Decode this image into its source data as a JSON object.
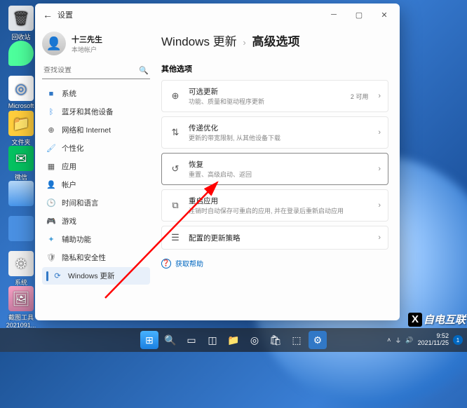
{
  "desktop": {
    "icons": [
      {
        "label": "回收站"
      },
      {
        "label": ""
      },
      {
        "label": "Microsoft Edge"
      },
      {
        "label": "文件夹"
      },
      {
        "label": "微信"
      },
      {
        "label": ""
      },
      {
        "label": ""
      },
      {
        "label": "系统"
      },
      {
        "label": "截图工具 2021091..."
      }
    ]
  },
  "window": {
    "title": "设置",
    "user": {
      "name": "十三先生",
      "sub": "本地帐户"
    },
    "search_placeholder": "查找设置",
    "nav": [
      {
        "icon": "■",
        "color": "#3178c6",
        "label": "系统"
      },
      {
        "icon": "ᛒ",
        "color": "#3a8ee8",
        "label": "蓝牙和其他设备"
      },
      {
        "icon": "⊕",
        "color": "#555",
        "label": "网络和 Internet"
      },
      {
        "icon": "🖌",
        "color": "#5aa8e8",
        "label": "个性化"
      },
      {
        "icon": "▦",
        "color": "#555",
        "label": "应用"
      },
      {
        "icon": "👤",
        "color": "#e88a3a",
        "label": "帐户"
      },
      {
        "icon": "🕒",
        "color": "#e87272",
        "label": "时间和语言"
      },
      {
        "icon": "🎮",
        "color": "#6fa05a",
        "label": "游戏"
      },
      {
        "icon": "✦",
        "color": "#4aa0d8",
        "label": "辅助功能"
      },
      {
        "icon": "🛡",
        "color": "#888",
        "label": "隐私和安全性"
      },
      {
        "icon": "⟳",
        "color": "#3178c6",
        "label": "Windows 更新"
      }
    ],
    "breadcrumb": {
      "parent": "Windows 更新",
      "current": "高级选项"
    },
    "section_title": "其他选项",
    "cards": [
      {
        "icon": "⊕",
        "title": "可选更新",
        "sub": "功能、质量和驱动程序更新",
        "meta": "2 可用"
      },
      {
        "icon": "⇅",
        "title": "传递优化",
        "sub": "更新的带宽限制, 从其他设备下载",
        "meta": ""
      },
      {
        "icon": "↺",
        "title": "恢复",
        "sub": "重置、高级启动、返回",
        "meta": "",
        "highlight": true
      },
      {
        "icon": "⧉",
        "title": "重启应用",
        "sub": "注销时自动保存可重启的应用, 并在登录后重新启动应用",
        "meta": ""
      },
      {
        "icon": "☰",
        "title": "配置的更新策略",
        "sub": "",
        "meta": ""
      }
    ],
    "help_label": "获取帮助"
  },
  "taskbar": {
    "time": "9:52",
    "date": "2021/11/25"
  },
  "watermark": "自电互联"
}
